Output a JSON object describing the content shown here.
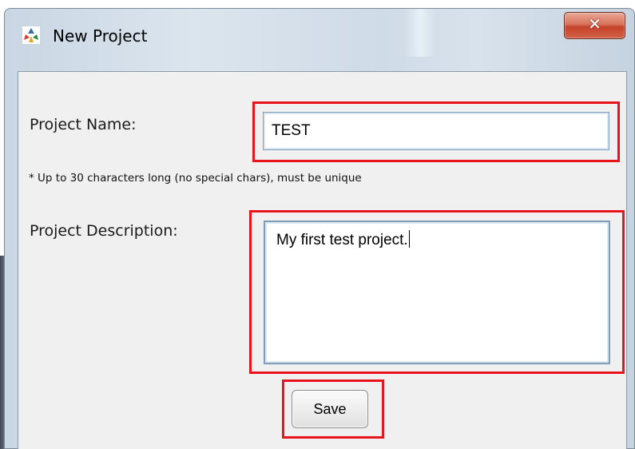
{
  "window": {
    "title": "New Project",
    "close_glyph": "✕",
    "icon": "app-logo-icon"
  },
  "form": {
    "name_label": "Project Name:",
    "name_value": "TEST",
    "name_hint": "* Up to 30 characters long (no special chars), must be unique",
    "description_label": "Project Description:",
    "description_value": "My first test project.",
    "save_label": "Save"
  },
  "colors": {
    "highlight": "#e8141c",
    "close_button": "#c4432a",
    "client_background": "#f0f0f0"
  }
}
